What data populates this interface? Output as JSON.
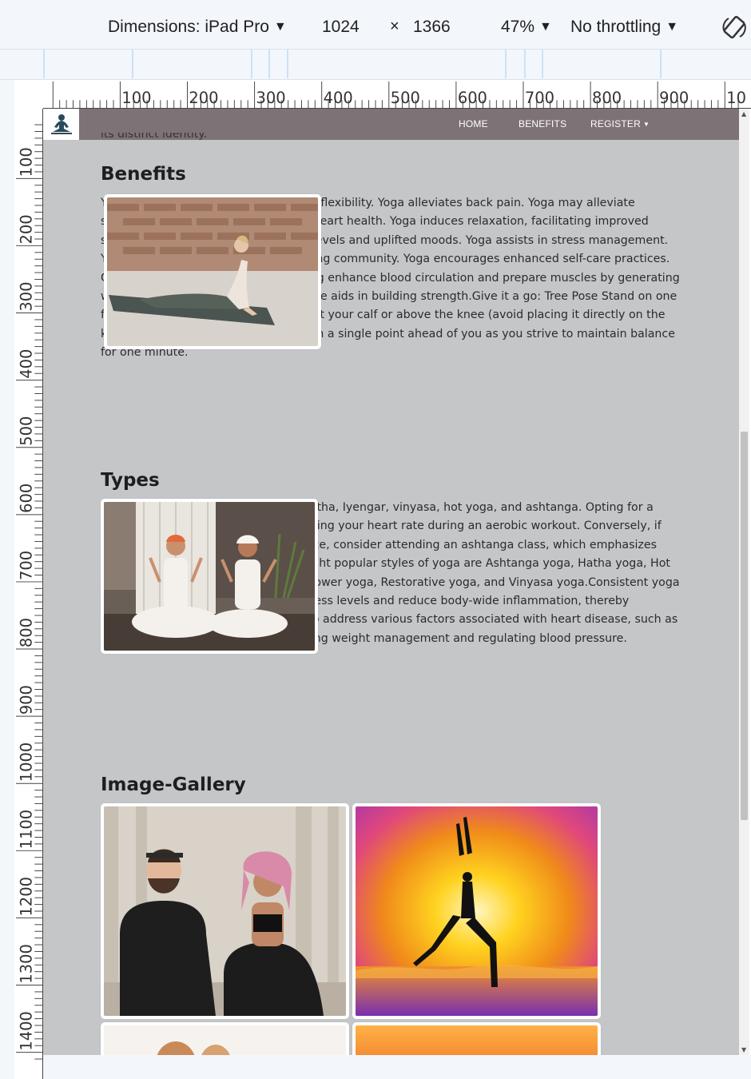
{
  "devtools": {
    "dimensions_label": "Dimensions: iPad Pro",
    "width": "1024",
    "times": "×",
    "height": "1366",
    "zoom": "47%",
    "throttling": "No throttling"
  },
  "ruler": {
    "top_ticks": [
      "100",
      "200",
      "300",
      "400",
      "500",
      "600",
      "700",
      "800",
      "900",
      "10"
    ],
    "left_ticks": [
      "100",
      "200",
      "300",
      "400",
      "500",
      "600",
      "700",
      "800",
      "900",
      "1000",
      "1100",
      "1200",
      "1300",
      "1400"
    ]
  },
  "nav": {
    "logo_icon": "meditation-pose-icon",
    "home": "HOME",
    "benefits": "BENEFITS",
    "register": "REGISTER"
  },
  "cut_text": "its distinct identity.",
  "benefits": {
    "title": "Benefits",
    "text": "Yoga enhances strength, balance, and flexibility. Yoga alleviates back pain. Yoga may alleviate symptoms of arthritis. Yoga supports heart health. Yoga induces relaxation, facilitating improved sleep. Yoga fosters increased energy levels and uplifted moods. Yoga assists in stress management. Yoga fosters connection with a nurturing community. Yoga encourages enhanced self-care practices. Gentle movements and deep breathing enhance blood circulation and prepare muscles by generating warmth, whereas maintaining a posture aids in building strength.Give it a go: Tree Pose Stand on one foot, with the other foot resting against your calf or above the knee (avoid placing it directly on the knee) at a right angle. Fix your gaze on a single point ahead of you as you strive to maintain balance for one minute."
  },
  "types": {
    "title": "Types",
    "text": "Different types of yoga encompass hatha, Iyengar, vinyasa, hot yoga, and ashtanga. Opting for a vinyasa class could be ideal for elevating your heart rate during an aerobic workout. Conversely, if you seek a more meditative experience, consider attending an ashtanga class, which emphasizes deliberate, mindful movement.The eight popular styles of yoga are Ashtanga yoga, Hatha yoga, Hot yoga, Iyengar yoga, Kundalini yoga, Power yoga, Restorative yoga, and Vinyasa yoga.Consistent yoga practice has the potential to lower stress levels and reduce body-wide inflammation, thereby supporting heart health. Yoga can also address various factors associated with heart disease, such as hypertension and obesity, by promoting weight management and regulating blood pressure."
  },
  "gallery": {
    "title": "Image-Gallery"
  },
  "colors": {
    "navbar": "#7d7276",
    "page_background": "#c4c6c8",
    "devtools_bar": "#f3f6fb"
  }
}
